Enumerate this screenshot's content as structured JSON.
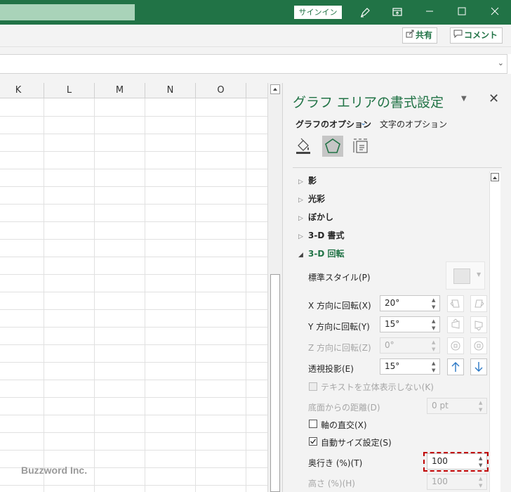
{
  "titlebar": {
    "signin_label": "サインイン",
    "icons": [
      "pen-icon",
      "restore-ribbon-icon",
      "minimize-icon",
      "maximize-icon",
      "close-icon"
    ]
  },
  "ribbon": {
    "share_label": "共有",
    "comment_label": "コメント"
  },
  "grid": {
    "columns": [
      "K",
      "L",
      "M",
      "N",
      "O"
    ]
  },
  "watermark": "Buzzword Inc.",
  "pane": {
    "title": "グラフ エリアの書式設定",
    "tab_graph": "グラフのオプション",
    "tab_text": "文字のオプション",
    "sections": {
      "shadow": "影",
      "glow": "光彩",
      "soft_edges": "ぼかし",
      "format_3d": "3-D 書式",
      "rotation_3d": "3-D 回転"
    },
    "preset_label": "標準スタイル(P)",
    "x_rotation_label": "X 方向に回転(X)",
    "x_rotation_value": "20°",
    "y_rotation_label": "Y 方向に回転(Y)",
    "y_rotation_value": "15°",
    "z_rotation_label": "Z 方向に回転(Z)",
    "z_rotation_value": "0°",
    "perspective_label": "透視投影(E)",
    "perspective_value": "15°",
    "keep_text_flat_label": "テキストを立体表示しない(K)",
    "distance_label": "底面からの距離(D)",
    "distance_value": "0 pt",
    "right_angle_axes_label": "軸の直交(X)",
    "autoscale_label": "自動サイズ設定(S)",
    "depth_label": "奥行き (%)(T)",
    "depth_value": "100",
    "height_label": "高さ (%)(H)",
    "height_value": "100",
    "checkbox_states": {
      "keep_text_flat": false,
      "right_angle_axes": false,
      "autoscale": true
    }
  },
  "colors": {
    "excel_green": "#217346",
    "highlight_red": "#c00000"
  }
}
